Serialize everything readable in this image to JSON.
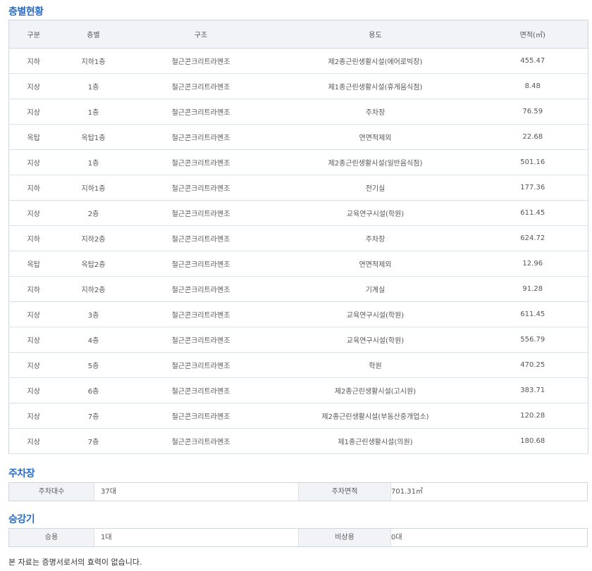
{
  "floor_section": {
    "title": "층별현황",
    "headers": [
      "구분",
      "층별",
      "구조",
      "용도",
      "면적(㎡)"
    ],
    "rows": [
      [
        "지하",
        "지하1층",
        "철근콘크리트라멘조",
        "제2종근린생활시설(에어로빅장)",
        "455.47"
      ],
      [
        "지상",
        "1층",
        "철근콘크리트라멘조",
        "제1종근린생활시설(휴게음식점)",
        "8.48"
      ],
      [
        "지상",
        "1층",
        "철근콘크리트라멘조",
        "주차장",
        "76.59"
      ],
      [
        "옥탑",
        "옥탑1층",
        "철근콘크리트라멘조",
        "연면적제외",
        "22.68"
      ],
      [
        "지상",
        "1층",
        "철근콘크리트라멘조",
        "제2종근린생활시설(일반음식점)",
        "501.16"
      ],
      [
        "지하",
        "지하1층",
        "철근콘크리트라멘조",
        "전기실",
        "177.36"
      ],
      [
        "지상",
        "2층",
        "철근콘크리트라멘조",
        "교육연구시설(학원)",
        "611.45"
      ],
      [
        "지하",
        "지하2층",
        "철근콘크리트라멘조",
        "주차장",
        "624.72"
      ],
      [
        "옥탑",
        "옥탑2층",
        "철근콘크리트라멘조",
        "연면적제외",
        "12.96"
      ],
      [
        "지하",
        "지하2층",
        "철근콘크리트라멘조",
        "기계실",
        "91.28"
      ],
      [
        "지상",
        "3층",
        "철근콘크리트라멘조",
        "교육연구시설(학원)",
        "611.45"
      ],
      [
        "지상",
        "4층",
        "철근콘크리트라멘조",
        "교육연구시설(학원)",
        "556.79"
      ],
      [
        "지상",
        "5층",
        "철근콘크리트라멘조",
        "학원",
        "470.25"
      ],
      [
        "지상",
        "6층",
        "철근콘크리트라멘조",
        "제2종근린생활시설(고시원)",
        "383.71"
      ],
      [
        "지상",
        "7층",
        "철근콘크리트라멘조",
        "제2종근린생활시설(부동산중개업소)",
        "120.28"
      ],
      [
        "지상",
        "7층",
        "철근콘크리트라멘조",
        "제1종근린생활시설(의원)",
        "180.68"
      ]
    ]
  },
  "parking": {
    "title": "주차장",
    "count_label": "주차대수",
    "count_value": "37대",
    "area_label": "주차면적",
    "area_value": "701.31㎡"
  },
  "elevator": {
    "title": "승강기",
    "passenger_label": "승용",
    "passenger_value": "1대",
    "emergency_label": "비상용",
    "emergency_value": "0대"
  },
  "note": "본 자료는 증명서로서의 효력이 없습니다.",
  "colors": {
    "accent": "#2a6cc4",
    "header_bg": "#f1f3f6",
    "border": "#cfd6de"
  }
}
